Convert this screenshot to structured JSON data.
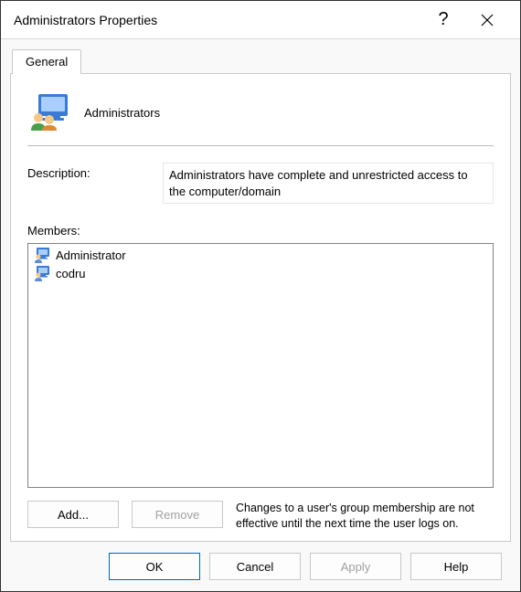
{
  "window": {
    "title": "Administrators Properties",
    "help_tooltip": "?",
    "close_tooltip": "Close"
  },
  "tabs": {
    "general_label": "General"
  },
  "group": {
    "name": "Administrators"
  },
  "description": {
    "label": "Description:",
    "value": "Administrators have complete and unrestricted access to the computer/domain"
  },
  "members": {
    "label": "Members:",
    "items": [
      {
        "name": "Administrator"
      },
      {
        "name": "codru"
      }
    ]
  },
  "hint": "Changes to a user's group membership are not effective until the next time the user logs on.",
  "buttons": {
    "add": "Add...",
    "remove": "Remove",
    "ok": "OK",
    "cancel": "Cancel",
    "apply": "Apply",
    "help": "Help"
  }
}
